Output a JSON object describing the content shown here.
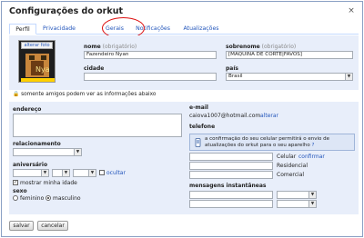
{
  "dialog": {
    "title": "Configurações do orkut",
    "close_label": "×"
  },
  "tabs": [
    "Perfil",
    "Privacidade",
    "Gerais",
    "Notificações",
    "Atualizações"
  ],
  "photo": {
    "link_label": "alterar foto"
  },
  "fields": {
    "nome_label": "nome",
    "nome_hint": "(obrigatório)",
    "nome_value": "Fazendeiro Nyan",
    "sobrenome_label": "sobrenome",
    "sobrenome_hint": "(obrigatório)",
    "sobrenome_value": "[MÁQUINA DE CORTE|FAVOS]",
    "cidade_label": "cidade",
    "cidade_value": "",
    "pais_label": "país",
    "pais_value": "Brasil"
  },
  "privacy_note": "somente amigos podem ver as informações abaixo",
  "left": {
    "endereco_label": "endereço",
    "relacionamento_label": "relacionamento",
    "aniversario_label": "aniversário",
    "ocultar_label": "ocultar",
    "mostrar_idade_label": "mostrar minha idade",
    "sexo_label": "sexo",
    "feminino_label": "feminino",
    "masculino_label": "masculino"
  },
  "right": {
    "email_label": "e-mail",
    "email_value": "caiova1007@hotmail.com",
    "alterar_label": "alterar",
    "telefone_label": "telefone",
    "telefone_info": "a confirmação do seu celular permitirá o envio de atualizações do orkut para o seu aparelho",
    "celular_label": "Celular",
    "confirmar_label": "confirmar",
    "residencial_label": "Residencial",
    "comercial_label": "Comercial",
    "mensagens_label": "mensagens instantâneas"
  },
  "buttons": {
    "save": "salvar",
    "cancel": "cancelar"
  }
}
